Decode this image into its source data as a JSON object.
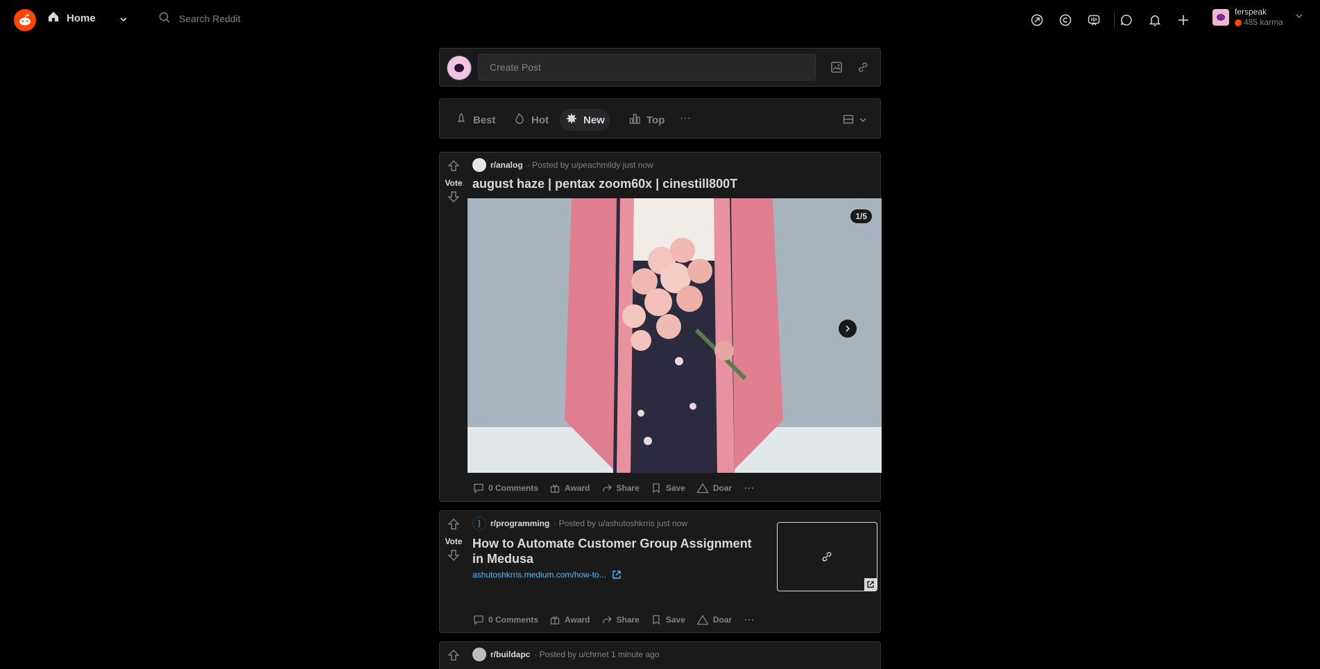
{
  "header": {
    "home_label": "Home",
    "search_placeholder": "Search Reddit",
    "icons": [
      "popular-icon",
      "coin-icon",
      "video-icon",
      "chat-icon",
      "bell-icon",
      "plus-icon"
    ],
    "user": {
      "name": "ferspeak",
      "karma": "485 karma"
    }
  },
  "create_post": {
    "placeholder": "Create Post"
  },
  "sort": {
    "items": [
      {
        "label": "Best",
        "icon": "rocket-icon"
      },
      {
        "label": "Hot",
        "icon": "flame-icon"
      },
      {
        "label": "New",
        "icon": "new-icon",
        "active": true
      },
      {
        "label": "Top",
        "icon": "top-icon"
      }
    ],
    "more": "···"
  },
  "posts": [
    {
      "subreddit": "r/analog",
      "byline": "· Posted by u/peachmildy just now",
      "vote_label": "Vote",
      "title": "august haze | pentax zoom60x | cinestill800T",
      "media_counter": "1/5",
      "comments": "0 Comments",
      "award": "Award",
      "share": "Share",
      "save": "Save",
      "doar": "Doar"
    },
    {
      "subreddit": "r/programming",
      "byline": "· Posted by u/ashutoshkrris just now",
      "vote_label": "Vote",
      "title": "How to Automate Customer Group Assignment in Medusa",
      "link": "ashutoshkrris.medium.com/how-to...",
      "comments": "0 Comments",
      "award": "Award",
      "share": "Share",
      "save": "Save",
      "doar": "Doar"
    },
    {
      "subreddit": "r/buildapc",
      "byline": "· Posted by u/chrnet 1 minute ago"
    }
  ],
  "colors": {
    "brand": "#ff4500",
    "link": "#4fbcff",
    "card": "#1a1a1b",
    "border": "#343536"
  }
}
